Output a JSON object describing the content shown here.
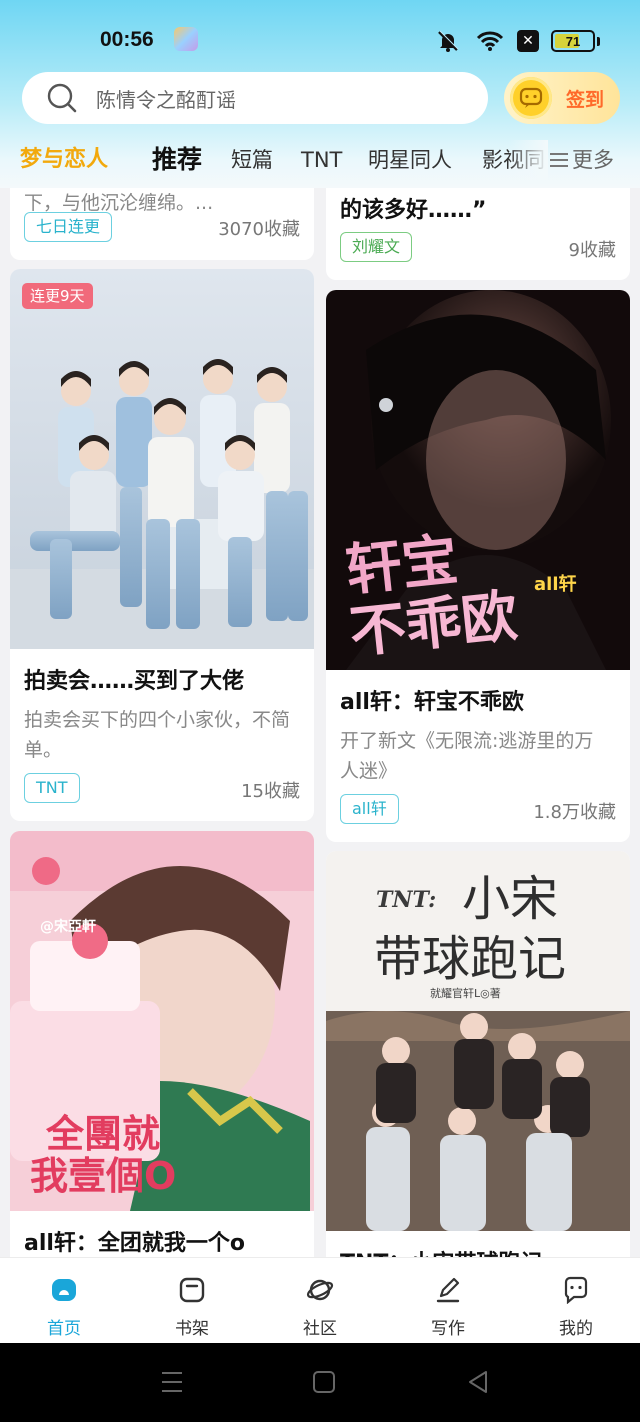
{
  "status": {
    "time": "00:56",
    "battery": "71",
    "battery_level": 0.71
  },
  "search": {
    "placeholder": "陈情令之酩酊谣"
  },
  "checkin": {
    "label": "签到"
  },
  "tabs": [
    {
      "label": "梦与恋人"
    },
    {
      "label": "推荐"
    },
    {
      "label": "短篇"
    },
    {
      "label": "TNT"
    },
    {
      "label": "明星同人"
    },
    {
      "label": "影视同人"
    }
  ],
  "more": {
    "label": "更多"
  },
  "cards": {
    "left_partial": {
      "desc": "下，与他沉沦缠绵。...",
      "tag": "七日连更",
      "fav": "3070收藏"
    },
    "right_partial": {
      "desc": "的该多好……”",
      "tag": "刘耀文",
      "fav": "9收藏"
    },
    "auction": {
      "badge": "连更9天",
      "title": "拍卖会……买到了大佬",
      "desc": "拍卖会买下的四个小家伙，不简单。",
      "tag": "TNT",
      "fav": "15收藏"
    },
    "xuanbao": {
      "cover_text_1": "轩宝",
      "cover_text_2": "不乖欧",
      "cover_tag": "all轩",
      "title": "all轩：轩宝不乖欧",
      "desc": "开了新文《无限流:逃游里的万人迷》",
      "tag": "all轩",
      "fav": "1.8万收藏"
    },
    "quantuan": {
      "cover_text_1": "全團就",
      "cover_text_2": "我壹個O",
      "cover_name": "@宋亞軒",
      "title": "all轩：全团就我一个o"
    },
    "xiaosong": {
      "cover_tnt": "TNT:",
      "cover_text_1": "小宋",
      "cover_text_2": "带球跑记",
      "cover_author": "就耀官轩L◎著",
      "title": "TNT：小宋带球跑记"
    }
  },
  "nav": [
    {
      "label": "首页",
      "icon": "home-icon"
    },
    {
      "label": "书架",
      "icon": "bookshelf-icon"
    },
    {
      "label": "社区",
      "icon": "community-icon"
    },
    {
      "label": "写作",
      "icon": "write-icon"
    },
    {
      "label": "我的",
      "icon": "profile-icon"
    }
  ],
  "colors": {
    "accent": "#1aa6d9",
    "tab_highlight": "#f2a90d",
    "checkin_text": "#ff6a2a",
    "badge_red": "#f16a7b"
  }
}
